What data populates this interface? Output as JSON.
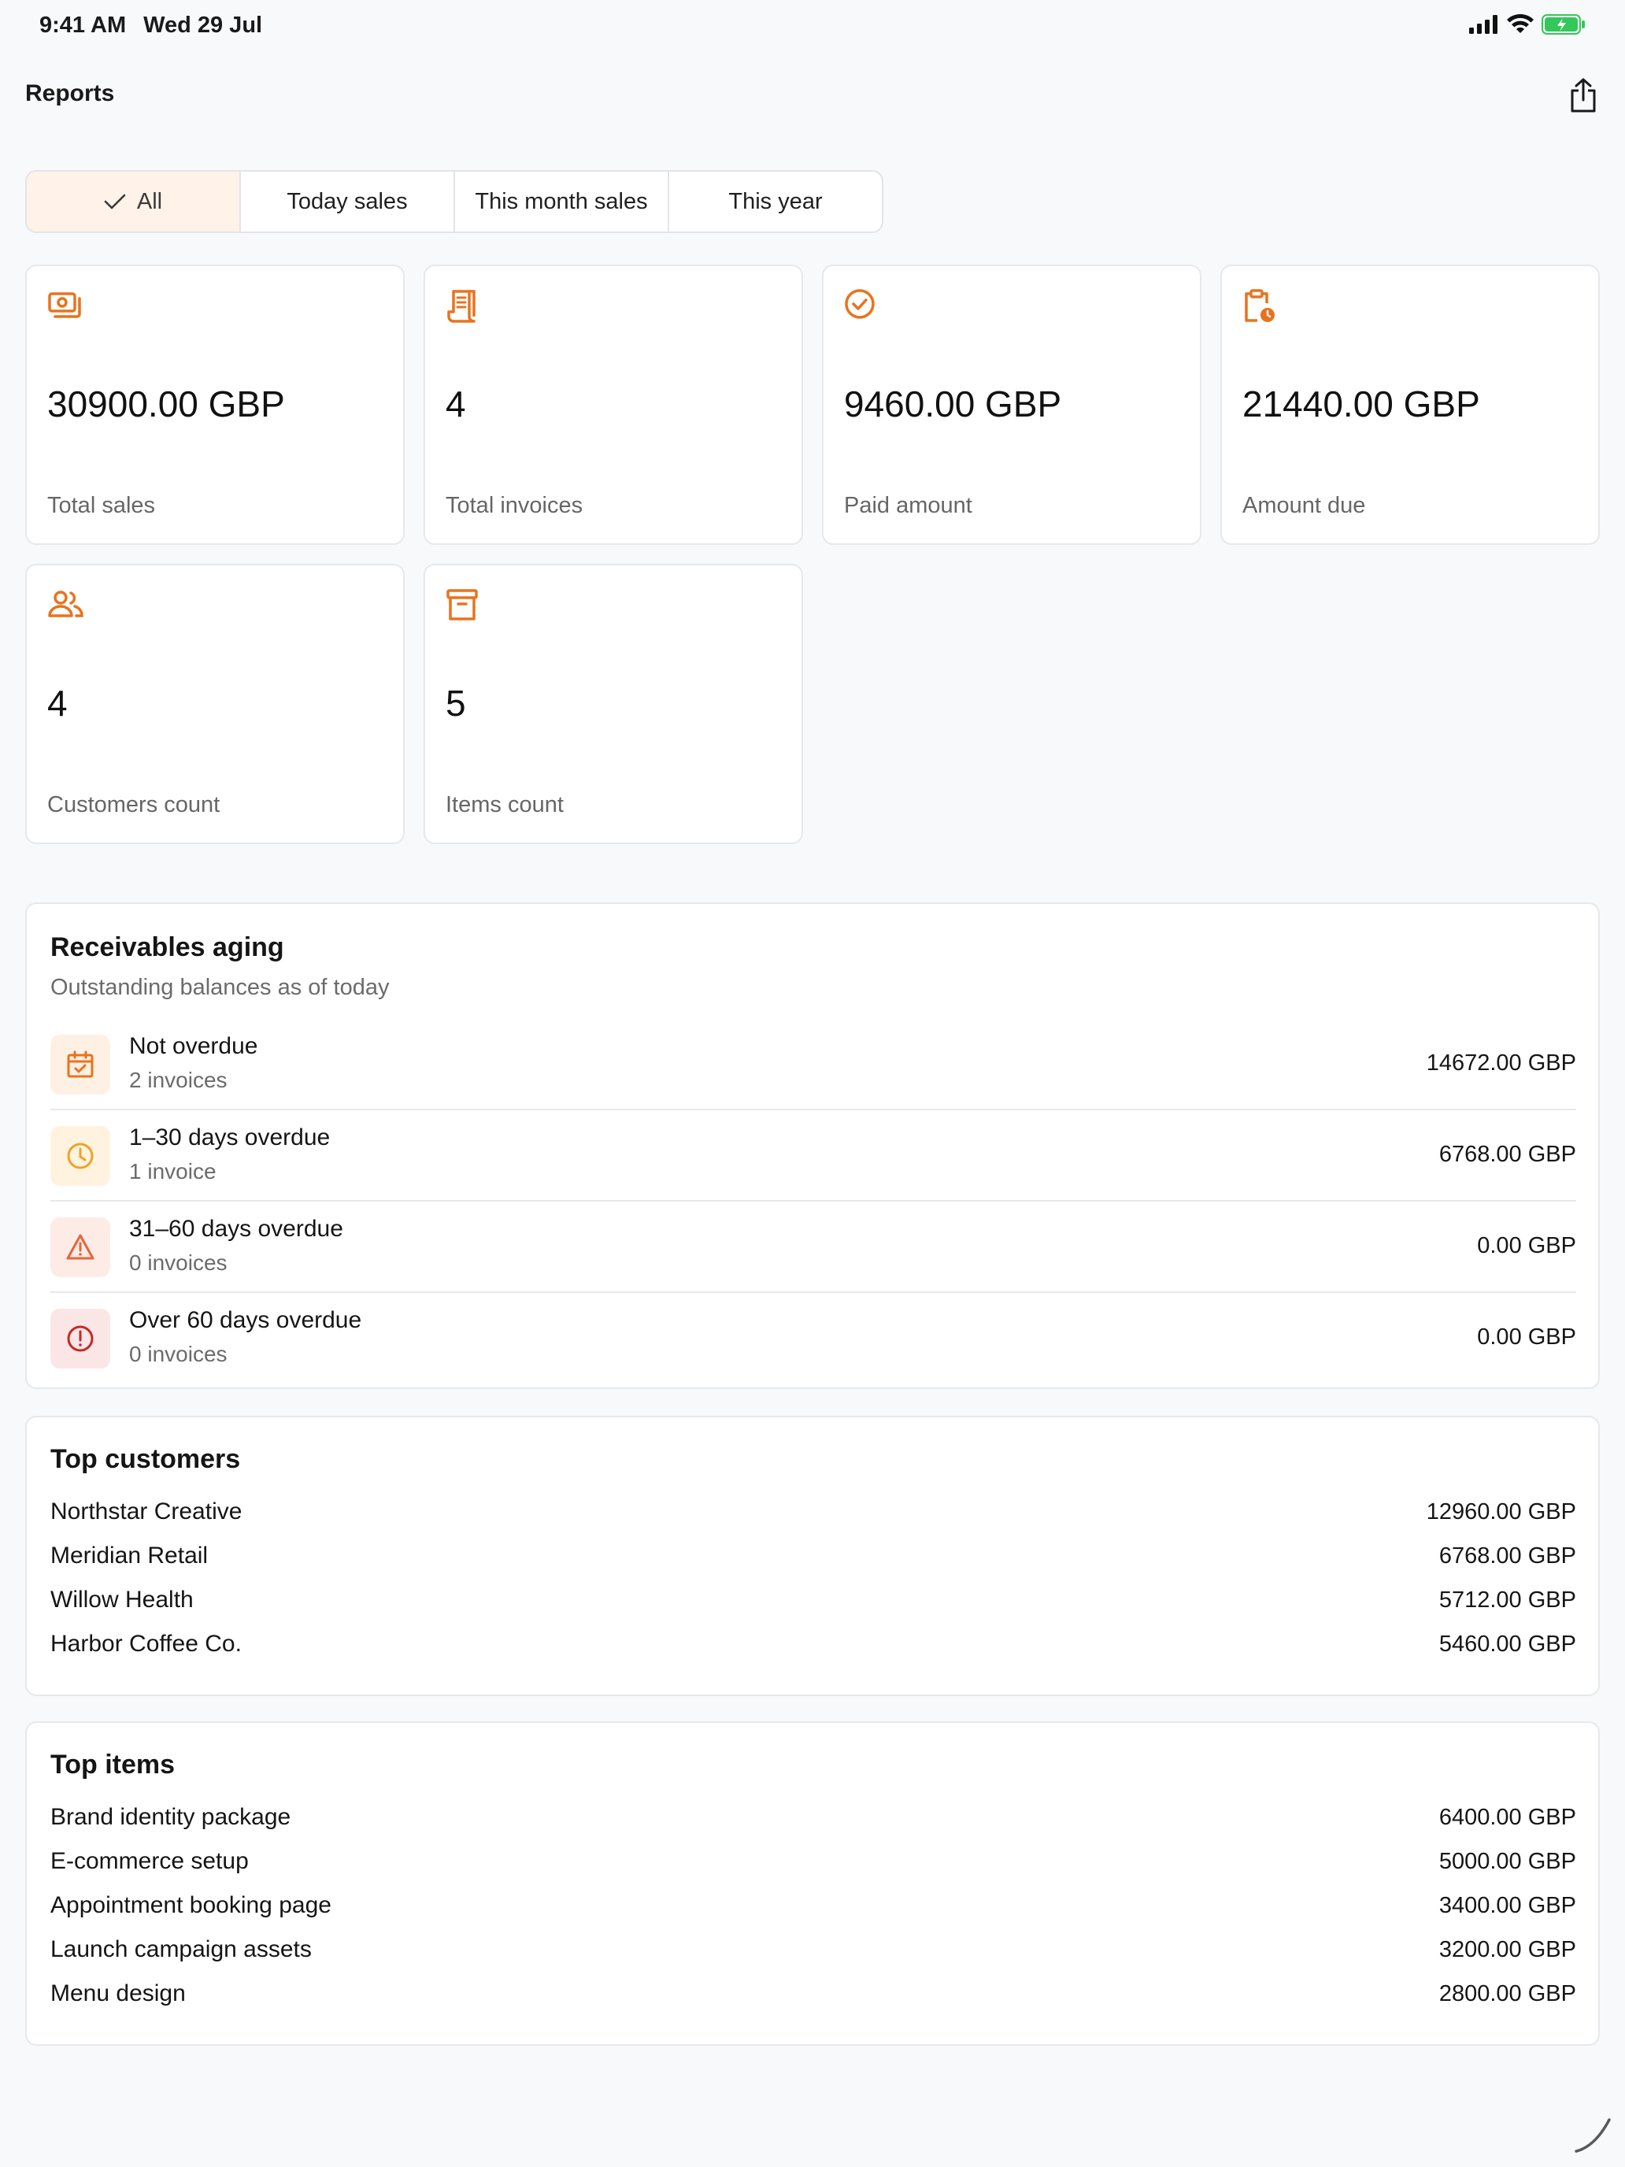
{
  "status_bar": {
    "time": "9:41 AM",
    "date": "Wed 29 Jul",
    "icons": [
      "cellular-signal-icon",
      "wifi-icon",
      "battery-charging-icon"
    ]
  },
  "header": {
    "title": "Reports",
    "share_icon": "share-icon"
  },
  "filters": {
    "items": [
      {
        "label": "All",
        "active": true
      },
      {
        "label": "Today sales",
        "active": false
      },
      {
        "label": "This month sales",
        "active": false
      },
      {
        "label": "This year",
        "active": false
      }
    ]
  },
  "stats": [
    {
      "icon": "money-icon",
      "value": "30900.00 GBP",
      "label": "Total sales"
    },
    {
      "icon": "receipt-icon",
      "value": "4",
      "label": "Total invoices"
    },
    {
      "icon": "check-circle-icon",
      "value": "9460.00 GBP",
      "label": "Paid amount"
    },
    {
      "icon": "clipboard-clock-icon",
      "value": "21440.00 GBP",
      "label": "Amount due"
    },
    {
      "icon": "users-icon",
      "value": "4",
      "label": "Customers count"
    },
    {
      "icon": "archive-box-icon",
      "value": "5",
      "label": "Items count"
    }
  ],
  "aging": {
    "title": "Receivables aging",
    "subtitle": "Outstanding balances as of today",
    "rows": [
      {
        "icon": "calendar-check-icon",
        "name": "Not overdue",
        "count": "2 invoices",
        "amount": "14672.00 GBP",
        "badge_bg": "#fff0e4",
        "icon_color": "#e8731e"
      },
      {
        "icon": "clock-icon",
        "name": "1–30 days overdue",
        "count": "1 invoice",
        "amount": "6768.00 GBP",
        "badge_bg": "#fff3e0",
        "icon_color": "#f0a326"
      },
      {
        "icon": "warning-triangle-icon",
        "name": "31–60 days overdue",
        "count": "0 invoices",
        "amount": "0.00 GBP",
        "badge_bg": "#fdece6",
        "icon_color": "#e8643a"
      },
      {
        "icon": "alert-circle-icon",
        "name": "Over 60 days overdue",
        "count": "0 invoices",
        "amount": "0.00 GBP",
        "badge_bg": "#fbe6e6",
        "icon_color": "#c62828"
      }
    ]
  },
  "top_customers": {
    "title": "Top customers",
    "rows": [
      {
        "name": "Northstar Creative",
        "amount": "12960.00 GBP"
      },
      {
        "name": "Meridian Retail",
        "amount": "6768.00 GBP"
      },
      {
        "name": "Willow Health",
        "amount": "5712.00 GBP"
      },
      {
        "name": "Harbor Coffee Co.",
        "amount": "5460.00 GBP"
      }
    ]
  },
  "top_items": {
    "title": "Top items",
    "rows": [
      {
        "name": "Brand identity package",
        "amount": "6400.00 GBP"
      },
      {
        "name": "E-commerce setup",
        "amount": "5000.00 GBP"
      },
      {
        "name": "Appointment booking page",
        "amount": "3400.00 GBP"
      },
      {
        "name": "Launch campaign assets",
        "amount": "3200.00 GBP"
      },
      {
        "name": "Menu design",
        "amount": "2800.00 GBP"
      }
    ]
  },
  "colors": {
    "accent": "#e8731e",
    "active_filter_bg": "#fff2e8",
    "battery": "#34c759"
  }
}
